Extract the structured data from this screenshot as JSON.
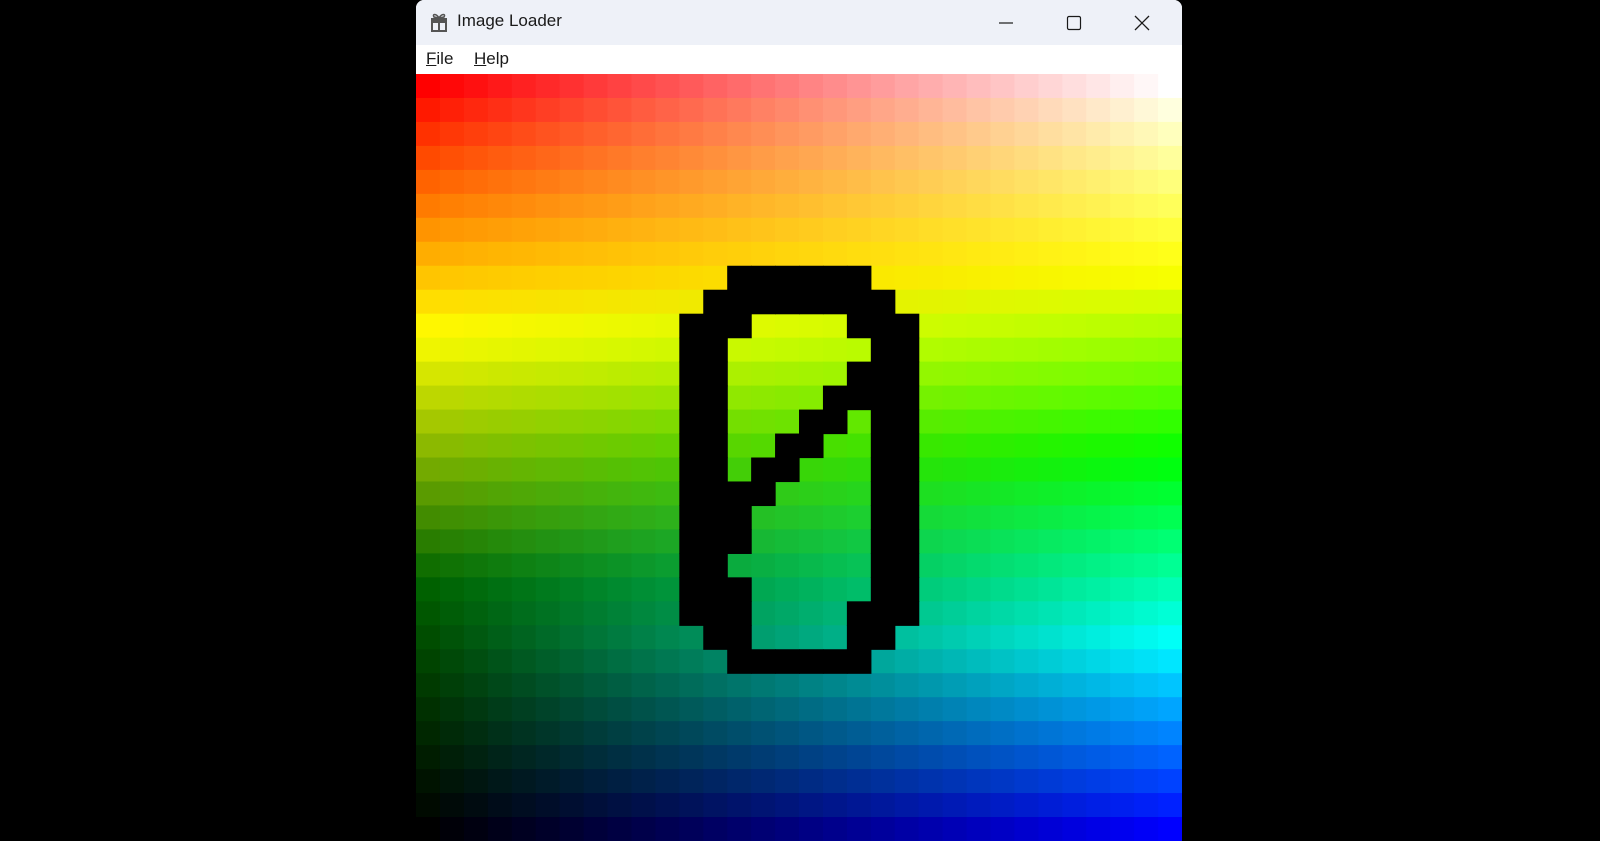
{
  "window": {
    "title": "Image Loader",
    "app_icon": "gift-box-icon",
    "controls": {
      "minimize": "minimize-icon",
      "maximize": "maximize-icon",
      "close": "close-icon"
    }
  },
  "menu": {
    "file": {
      "mnemonic": "F",
      "rest": "ile"
    },
    "help": {
      "mnemonic": "H",
      "rest": "elp"
    }
  },
  "image": {
    "grid_size": 32,
    "corner_colors": {
      "top_left": "#ff0000",
      "top_right": "#ffffff",
      "middle_left": "#006400",
      "bottom_left": "#000000",
      "bottom_right": "#0000ff",
      "yellow": "#ffff00",
      "green": "#00ff00",
      "cyan": "#00ffff"
    },
    "glyph": "0",
    "glyph_color": "#000000"
  }
}
